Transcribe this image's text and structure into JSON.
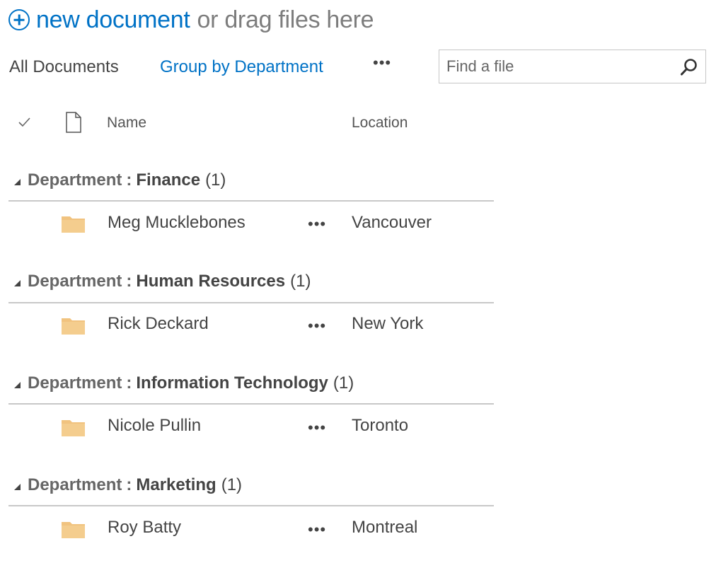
{
  "header": {
    "new_document_label": "new document",
    "drag_text": "or drag files here",
    "accent_color": "#0072c6"
  },
  "views": {
    "all_documents": "All Documents",
    "group_by_department": "Group by Department",
    "more": "•••"
  },
  "search": {
    "placeholder": "Find a file",
    "icon": "search-icon"
  },
  "columns": {
    "check_icon": "checkmark-icon",
    "type_icon": "document-icon",
    "name": "Name",
    "location": "Location"
  },
  "groups": [
    {
      "field": "Department",
      "separator": ":",
      "value": "Finance",
      "count": "(1)",
      "items": [
        {
          "name": "Meg Mucklebones",
          "more": "•••",
          "location": "Vancouver",
          "icon": "folder-icon"
        }
      ]
    },
    {
      "field": "Department",
      "separator": ":",
      "value": "Human Resources",
      "count": "(1)",
      "items": [
        {
          "name": "Rick Deckard",
          "more": "•••",
          "location": "New York",
          "icon": "folder-icon"
        }
      ]
    },
    {
      "field": "Department",
      "separator": ":",
      "value": "Information Technology",
      "count": "(1)",
      "items": [
        {
          "name": "Nicole Pullin",
          "more": "•••",
          "location": "Toronto",
          "icon": "folder-icon"
        }
      ]
    },
    {
      "field": "Department",
      "separator": ":",
      "value": "Marketing",
      "count": "(1)",
      "items": [
        {
          "name": "Roy Batty",
          "more": "•••",
          "location": "Montreal",
          "icon": "folder-icon"
        }
      ]
    }
  ]
}
